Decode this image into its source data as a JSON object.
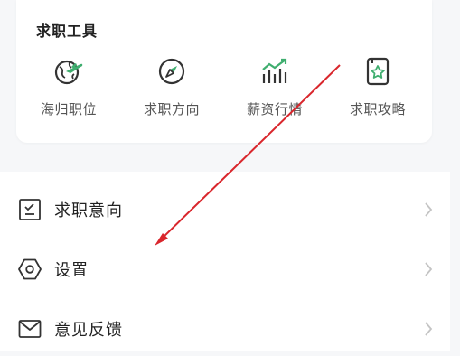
{
  "job_tools": {
    "title": "求职工具",
    "items": [
      {
        "label": "海归职位",
        "icon": "globe-plane-icon"
      },
      {
        "label": "求职方向",
        "icon": "compass-icon"
      },
      {
        "label": "薪资行情",
        "icon": "salary-chart-icon"
      },
      {
        "label": "求职攻略",
        "icon": "guide-book-icon"
      }
    ]
  },
  "menu": {
    "items": [
      {
        "label": "求职意向",
        "icon": "checklist-icon"
      },
      {
        "label": "设置",
        "icon": "settings-hexagon-icon"
      },
      {
        "label": "意见反馈",
        "icon": "mail-icon"
      }
    ]
  },
  "colors": {
    "accent": "#3fae6f",
    "annotation_arrow": "#d9262c",
    "icon_stroke": "#333333",
    "chevron": "#c4c4c4"
  }
}
